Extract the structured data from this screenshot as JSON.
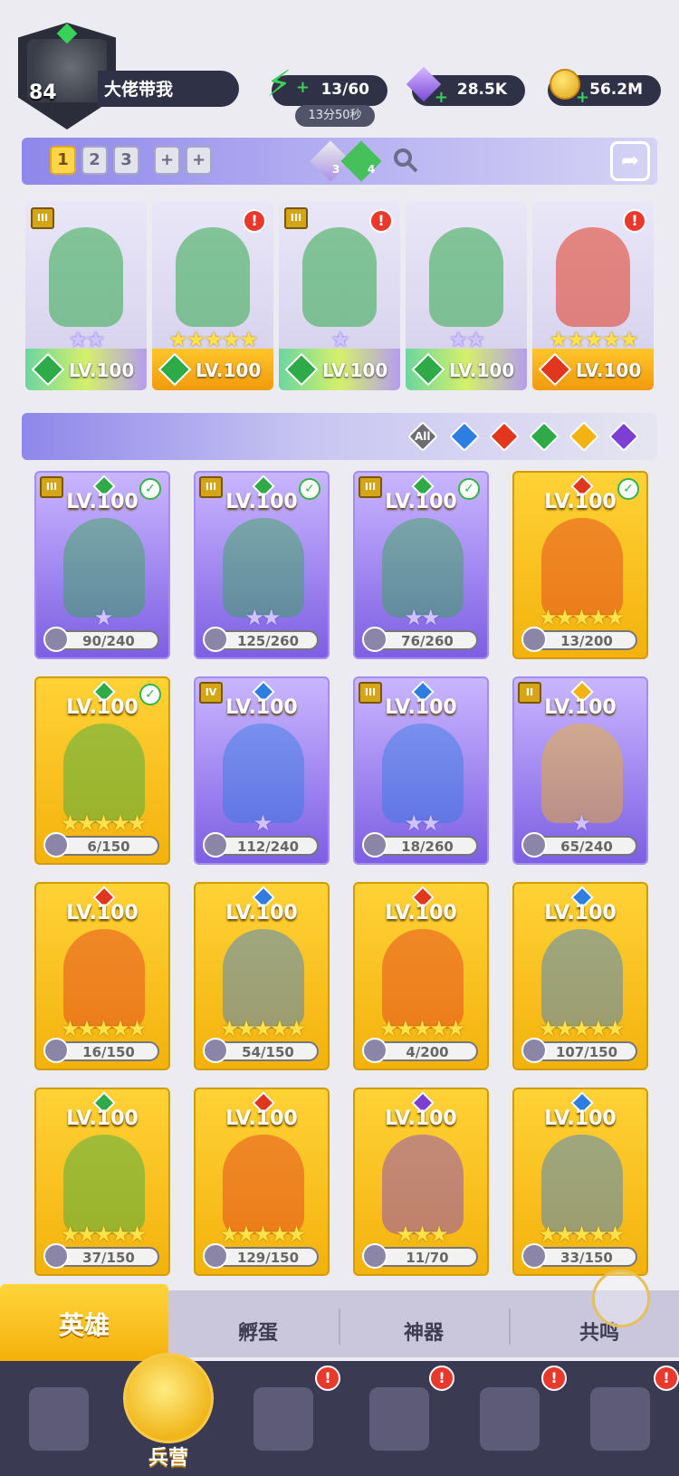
{
  "player": {
    "level": "84",
    "name": "大佬带我"
  },
  "resources": {
    "energy": "13/60",
    "energy_timer": "13分50秒",
    "gems": "28.5K",
    "gold": "56.2M"
  },
  "teams": {
    "tabs": [
      "1",
      "2",
      "3",
      "+",
      "+"
    ],
    "active": "1",
    "pet_a_count": "3",
    "pet_b_count": "4"
  },
  "team_cards": [
    {
      "level": "LV.100",
      "stars": "★★",
      "element": "nature",
      "tier": "III",
      "alert": false
    },
    {
      "level": "LV.100",
      "stars": "★★★★★",
      "element": "nature",
      "tier": "",
      "alert": true
    },
    {
      "level": "LV.100",
      "stars": "★",
      "element": "nature",
      "tier": "III",
      "alert": true
    },
    {
      "level": "LV.100",
      "stars": "★★",
      "element": "nature",
      "tier": "",
      "alert": false
    },
    {
      "level": "LV.100",
      "stars": "★★★★★",
      "element": "fire",
      "tier": "",
      "alert": true
    }
  ],
  "filters": {
    "all_label": "All",
    "elements": [
      "water",
      "fire",
      "nature",
      "light",
      "dark"
    ]
  },
  "heroes": [
    {
      "level": "LV.100",
      "progress": "90/240",
      "stars": "★",
      "frame": "purple",
      "element": "nature",
      "tier": "III",
      "check": true
    },
    {
      "level": "LV.100",
      "progress": "125/260",
      "stars": "★★",
      "frame": "purple",
      "element": "nature",
      "tier": "III",
      "check": true
    },
    {
      "level": "LV.100",
      "progress": "76/260",
      "stars": "★★",
      "frame": "purple",
      "element": "nature",
      "tier": "III",
      "check": true
    },
    {
      "level": "LV.100",
      "progress": "13/200",
      "stars": "★★★★★",
      "frame": "gold",
      "element": "fire",
      "tier": "",
      "check": true
    },
    {
      "level": "LV.100",
      "progress": "6/150",
      "stars": "★★★★★",
      "frame": "gold",
      "element": "nature",
      "tier": "",
      "check": true
    },
    {
      "level": "LV.100",
      "progress": "112/240",
      "stars": "★",
      "frame": "purple",
      "element": "water",
      "tier": "IV",
      "check": false
    },
    {
      "level": "LV.100",
      "progress": "18/260",
      "stars": "★★",
      "frame": "purple",
      "element": "water",
      "tier": "III",
      "check": false
    },
    {
      "level": "LV.100",
      "progress": "65/240",
      "stars": "★",
      "frame": "purple",
      "element": "light",
      "tier": "II",
      "check": false
    },
    {
      "level": "LV.100",
      "progress": "16/150",
      "stars": "★★★★★",
      "frame": "gold",
      "element": "fire",
      "tier": "",
      "check": false
    },
    {
      "level": "LV.100",
      "progress": "54/150",
      "stars": "★★★★★",
      "frame": "gold",
      "element": "water",
      "tier": "",
      "check": false
    },
    {
      "level": "LV.100",
      "progress": "4/200",
      "stars": "★★★★★",
      "frame": "gold",
      "element": "fire",
      "tier": "",
      "check": false
    },
    {
      "level": "LV.100",
      "progress": "107/150",
      "stars": "★★★★★",
      "frame": "gold",
      "element": "water",
      "tier": "",
      "check": false
    },
    {
      "level": "LV.100",
      "progress": "37/150",
      "stars": "★★★★★",
      "frame": "gold",
      "element": "nature",
      "tier": "",
      "check": false
    },
    {
      "level": "LV.100",
      "progress": "129/150",
      "stars": "★★★★★",
      "frame": "gold",
      "element": "fire",
      "tier": "",
      "check": false
    },
    {
      "level": "LV.100",
      "progress": "11/70",
      "stars": "★★★",
      "frame": "gold",
      "element": "dark",
      "tier": "",
      "check": false
    },
    {
      "level": "LV.100",
      "progress": "33/150",
      "stars": "★★★★★",
      "frame": "gold",
      "element": "water",
      "tier": "",
      "check": false
    }
  ],
  "sub_tabs": {
    "heroes": "英雄",
    "hatch": "孵蛋",
    "artifacts": "神器",
    "resonance": "共鸣"
  },
  "nav": {
    "barracks_label": "兵营"
  },
  "colors": {
    "water": "#2e7de0",
    "fire": "#e0381f",
    "nature": "#2faa48",
    "light": "#f1b412",
    "dark": "#7c3fd2",
    "accent": "#ffd236"
  }
}
